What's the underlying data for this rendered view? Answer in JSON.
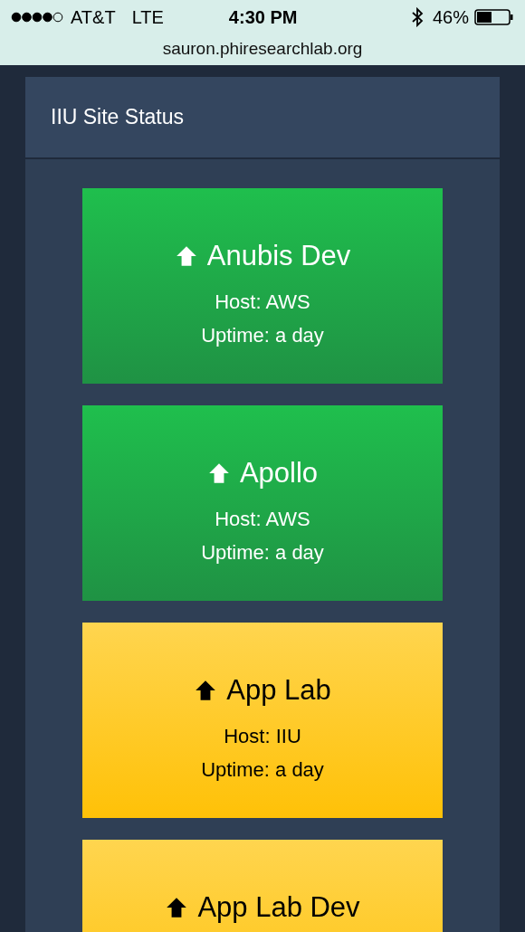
{
  "status_bar": {
    "carrier": "AT&T",
    "network": "LTE",
    "time": "4:30 PM",
    "battery": "46%",
    "url": "sauron.phiresearchlab.org"
  },
  "panel": {
    "title": "IIU Site Status"
  },
  "sites": [
    {
      "name": "Anubis Dev",
      "host": "Host: AWS",
      "uptime": "Uptime: a day",
      "color": "#1fbf4d"
    },
    {
      "name": "Apollo",
      "host": "Host: AWS",
      "uptime": "Uptime: a day",
      "color": "#1fbf4d"
    },
    {
      "name": "App Lab",
      "host": "Host: IIU",
      "uptime": "Uptime: a day",
      "color": "#ffcc33"
    },
    {
      "name": "App Lab Dev",
      "color": "#ffcc33"
    }
  ]
}
